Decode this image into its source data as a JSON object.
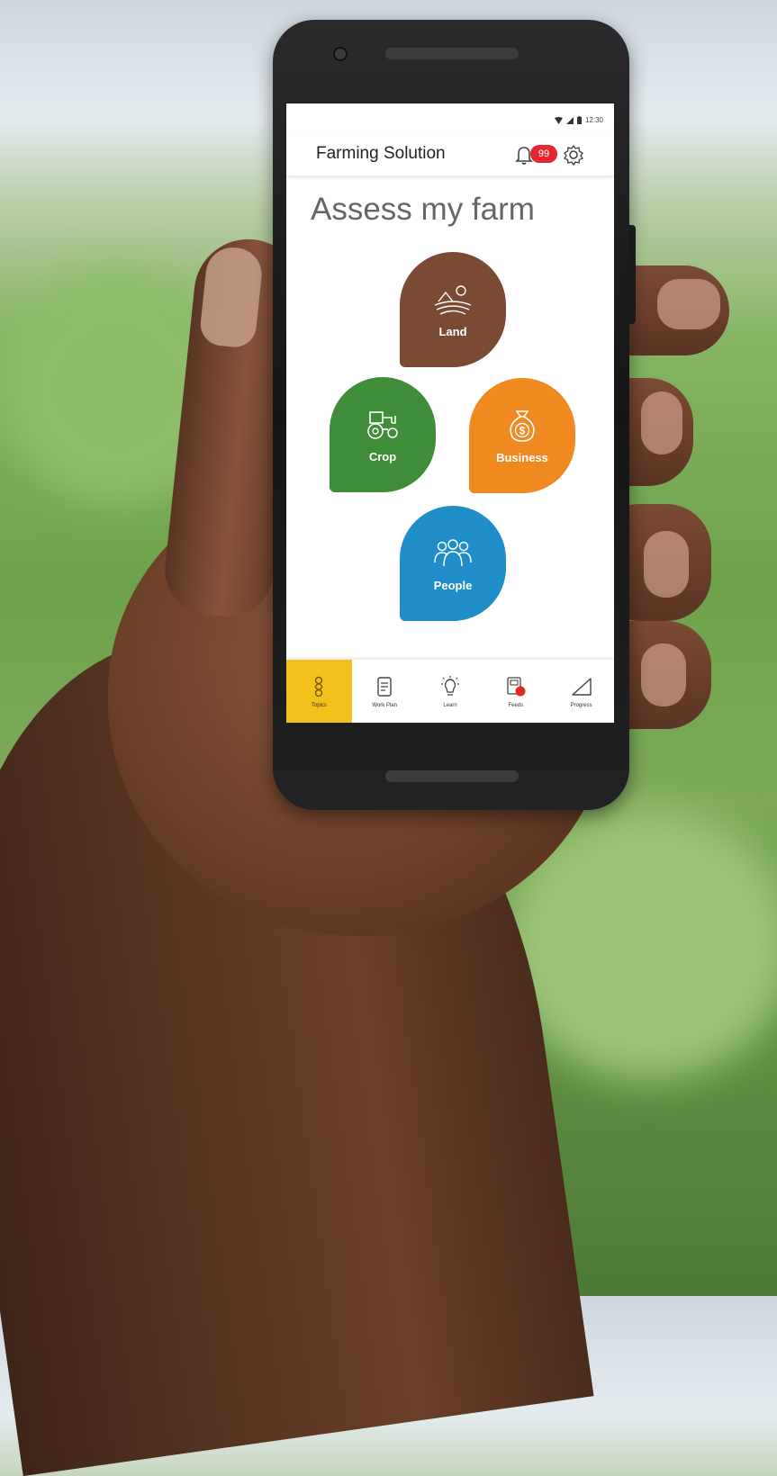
{
  "app": {
    "title": "Farming Solution",
    "status_time": "12:30",
    "notification_count": "99"
  },
  "main": {
    "heading": "Assess my farm",
    "categories": [
      {
        "label": "Land",
        "icon": "land-icon",
        "color": "#7b4a32"
      },
      {
        "label": "Crop",
        "icon": "tractor-icon",
        "color": "#3f8c39"
      },
      {
        "label": "Business",
        "icon": "money-bag-icon",
        "color": "#f0891f"
      },
      {
        "label": "People",
        "icon": "people-icon",
        "color": "#1f8ec8"
      }
    ]
  },
  "bottom_nav": {
    "items": [
      {
        "label": "Topics",
        "icon": "topics-icon",
        "active": true
      },
      {
        "label": "Work Plan",
        "icon": "clipboard-icon",
        "active": false
      },
      {
        "label": "Learn",
        "icon": "lightbulb-icon",
        "active": false
      },
      {
        "label": "Feeds",
        "icon": "feeds-icon",
        "active": false
      },
      {
        "label": "Progress",
        "icon": "progress-icon",
        "active": false
      }
    ],
    "active_color": "#f2c11c"
  }
}
